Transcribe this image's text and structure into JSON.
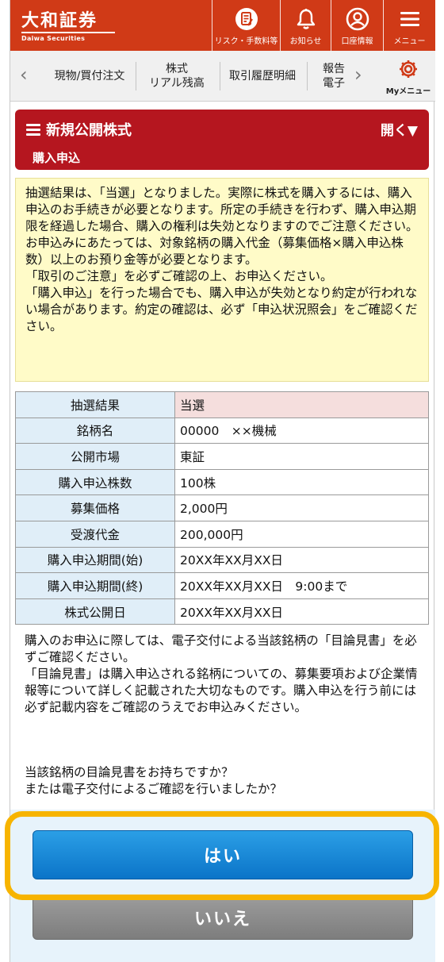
{
  "header": {
    "logo_text": "大和証券",
    "logo_sub": "Daiwa Securities",
    "buttons": [
      {
        "label": "リスク・手数料等",
        "icon": "document-pen-icon"
      },
      {
        "label": "お知らせ",
        "icon": "bell-icon"
      },
      {
        "label": "口座情報",
        "icon": "user-circle-icon"
      },
      {
        "label": "メニュー",
        "icon": "hamburger-menu-icon"
      }
    ]
  },
  "subnav": {
    "items": [
      "現物/買付注文",
      "株式\nリアル残高",
      "取引履歴明細",
      "報告\n電子"
    ],
    "mymenu_label": "Myメニュー",
    "mymenu_icon": "gear-icon"
  },
  "section": {
    "title": "新規公開株式",
    "toggle": "開く▼",
    "subtitle": "購入申込"
  },
  "notice": {
    "text": "抽選結果は、「当選」となりました。実際に株式を購入するには、購入申込のお手続きが必要となります。所定の手続きを行わず、購入申込期限を経過した場合、購入の権利は失効となりますのでご注意ください。\nお申込みにあたっては、対象銘柄の購入代金（募集価格×購入申込株数）以上のお預り金等が必要となります。\n「取引のご注意」を必ずご確認の上、お申込ください。\n「購入申込」を行った場合でも、購入申込が失効となり約定が行われない場合があります。約定の確認は、必ず「申込状況照会」をご確認ください。"
  },
  "details": [
    {
      "label": "抽選結果",
      "value": "当選"
    },
    {
      "label": "銘柄名",
      "value": "00000　××機械"
    },
    {
      "label": "公開市場",
      "value": "東証"
    },
    {
      "label": "購入申込株数",
      "value": "100株"
    },
    {
      "label": "募集価格",
      "value": "2,000円"
    },
    {
      "label": "受渡代金",
      "value": "200,000円"
    },
    {
      "label": "購入申込期間(始)",
      "value": "20XX年XX月XX日"
    },
    {
      "label": "購入申込期間(終)",
      "value": "20XX年XX月XX日　9:00まで"
    },
    {
      "label": "株式公開日",
      "value": "20XX年XX月XX日"
    }
  ],
  "body": {
    "paragraph1": "購入のお申込に際しては、電子交付による当該銘柄の「目論見書」を必ずご確認ください。\n「目論見書」は購入申込される銘柄についての、募集要項および企業情報等について詳しく記載された大切なものです。購入申込を行う前には必ず記載内容をご確認のうえでお申込みください。",
    "paragraph2": "当該銘柄の目論見書をお持ちですか？\nまたは電子交付によるご確認を行いましたか？"
  },
  "actions": {
    "yes_label": "はい",
    "no_label": "いいえ"
  },
  "colors": {
    "header_bg": "#d03a17",
    "section_bg": "#b5161f",
    "notice_bg": "#fffbc8",
    "table_key_bg": "#e0eef8",
    "highlight_row_bg": "#f5dedd",
    "yes_button": "#1a8ad8",
    "no_button": "#8a8a8a",
    "focus_ring": "#f7b400"
  }
}
